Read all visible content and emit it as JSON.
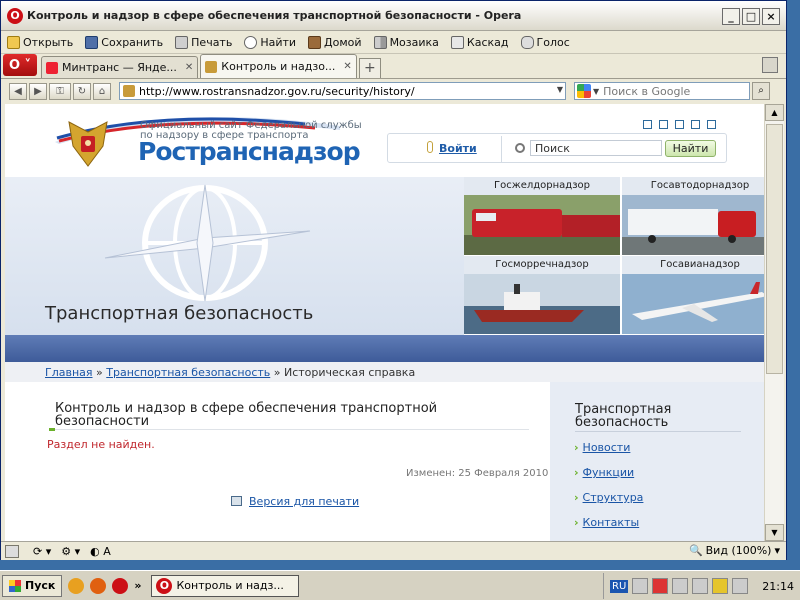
{
  "window": {
    "title": "Контроль и надзор в сфере обеспечения транспортной безопасности - Opera",
    "buttons": [
      "_",
      "□",
      "×"
    ]
  },
  "menubar": [
    {
      "label": "Открыть",
      "icon": "folder-icon"
    },
    {
      "label": "Сохранить",
      "icon": "disk-icon"
    },
    {
      "label": "Печать",
      "icon": "printer-icon"
    },
    {
      "label": "Найти",
      "icon": "search-icon"
    },
    {
      "label": "Домой",
      "icon": "home-icon"
    },
    {
      "label": "Мозаика",
      "icon": "tile-icon"
    },
    {
      "label": "Каскад",
      "icon": "cascade-icon"
    },
    {
      "label": "Голос",
      "icon": "voice-icon"
    }
  ],
  "tabs": [
    {
      "label": "Минтранс — Янде...",
      "active": false
    },
    {
      "label": "Контроль и надзо...",
      "active": true
    }
  ],
  "address": {
    "url": "http://www.rostransnadzor.gov.ru/security/history/",
    "search_placeholder": "Поиск в Google"
  },
  "site": {
    "official_line1": "Официальный сайт Федеральной службы",
    "official_line2": "по надзору в сфере транспорта",
    "name": "Ространснадзор",
    "login": "Войти",
    "search_value": "Поиск",
    "search_button": "Найти",
    "hero_title": "Транспортная безопасность",
    "agencies": [
      "Госжелдорнадзор",
      "Госавтодорнадзор",
      "Госморречнадзор",
      "Госавианадзор"
    ]
  },
  "breadcrumb": {
    "home": "Главная",
    "sep1": " » ",
    "section": "Транспортная безопасность",
    "sep2": " » ",
    "current": "Историческая справка"
  },
  "content": {
    "title": "Контроль и надзор в сфере обеспечения транспортной безопасности",
    "error": "Раздел не найден.",
    "changed": "Изменен: 25 Февраля 2010",
    "print_version": "Версия для печати"
  },
  "sidebar": {
    "title": "Транспортная безопасность",
    "links": [
      "Новости",
      "Функции",
      "Структура",
      "Контакты"
    ]
  },
  "statusbar": {
    "zoom": "Вид (100%)"
  },
  "taskbar": {
    "start": "Пуск",
    "window": "Контроль и надз...",
    "lang": "RU",
    "clock": "21:14"
  },
  "colors": {
    "brand_blue": "#1f64b4",
    "error_red": "#c0272d",
    "accent_green": "#6bb12b",
    "band_blue": "#3e5b99"
  }
}
